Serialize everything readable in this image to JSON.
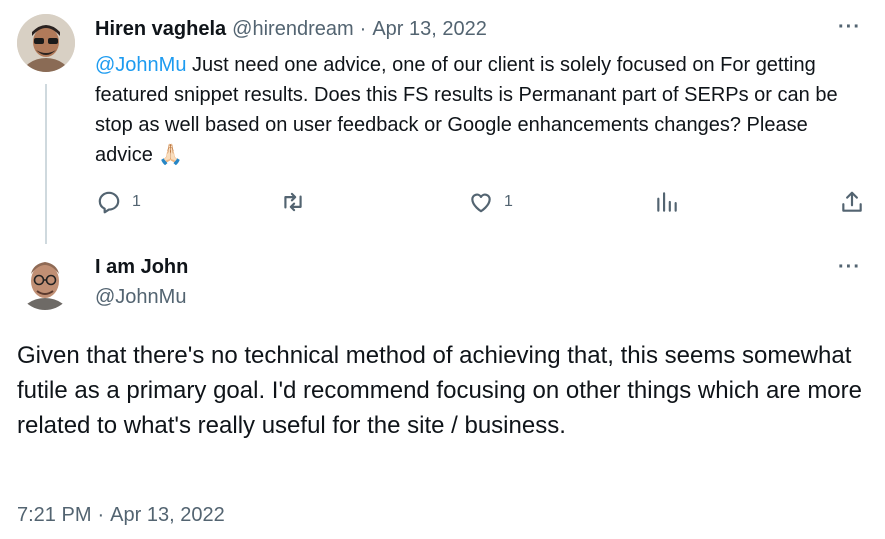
{
  "reply": {
    "author_name": "Hiren vaghela",
    "author_handle": "@hirendream",
    "separator": "·",
    "date": "Apr 13, 2022",
    "mention": "@JohnMu",
    "text": " Just need one advice, one of our client is solely focused on For getting featured snippet results. Does this FS results is Permanant part of SERPs or can be stop as well based on user feedback or Google enhancements changes? Please advice ",
    "emoji": "🙏🏻",
    "actions": {
      "reply_count": "1",
      "retweet_count": "",
      "like_count": "1"
    }
  },
  "main": {
    "author_name": "I am John",
    "author_handle": "@JohnMu",
    "text": "Given that there's no technical method of achieving that, this seems somewhat futile as a primary goal. I'd recommend focusing on other things which are more related to what's really useful for the site / business.",
    "time": "7:21 PM",
    "separator": "·",
    "date": "Apr 13, 2022"
  },
  "more_label": "···",
  "colors": {
    "text": "#0f1419",
    "secondary": "#536471",
    "link": "#1d9bf0",
    "thread_line": "#cfd9de"
  }
}
